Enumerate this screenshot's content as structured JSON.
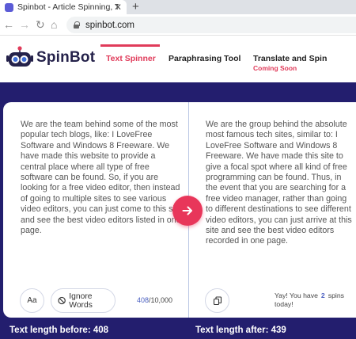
{
  "browser": {
    "tab_title": "Spinbot - Article Spinning, Text R",
    "tab_close": "✕",
    "new_tab": "+",
    "url": "spinbot.com"
  },
  "header": {
    "brand": "SpinBot",
    "nav": {
      "text_spinner": "Text Spinner",
      "paraphrasing_tool": "Paraphrasing Tool",
      "translate_and_spin": "Translate and Spin",
      "coming_soon": "Coming Soon"
    }
  },
  "editor": {
    "input_text": "We are the team behind some of the most popular tech blogs, like: I LoveFree Software and Windows 8 Freeware. We have made this website to provide a central place where all type of free software can be found. So, if you are looking for a free video editor, then instead of going to multiple sites to see various video editors, you can just come to this site and see the best video editors listed in one page.",
    "output_text": "We are the group behind the absolute most famous tech sites, similar to: I LoveFree Software and Windows 8 Freeware. We have made this site to give a focal spot where all kind of free programming can be found. Thus, in the event that you are searching for a free video manager, rather than going to different destinations to see different video editors, you can just arrive at this site and see the best video editors recorded in one page.",
    "aa_label": "Aa",
    "ignore_words_label": "Ignore Words",
    "char_count_current": "408",
    "char_count_max": "/10,000",
    "spins_prefix": "Yay! You have",
    "spins_count": "2",
    "spins_word": "spins",
    "spins_suffix": "today!"
  },
  "stats": {
    "before": "Text length before: 408",
    "after": "Text length after: 439"
  },
  "colors": {
    "accent": "#e03b5a",
    "band": "#231e6e",
    "link_blue": "#4a5fc1"
  },
  "icons": [
    "favicon",
    "back-arrow-icon",
    "forward-arrow-icon",
    "reload-icon",
    "home-icon",
    "lock-icon",
    "spinbot-robot-logo",
    "arrow-right-icon",
    "block-icon",
    "copy-icon"
  ]
}
